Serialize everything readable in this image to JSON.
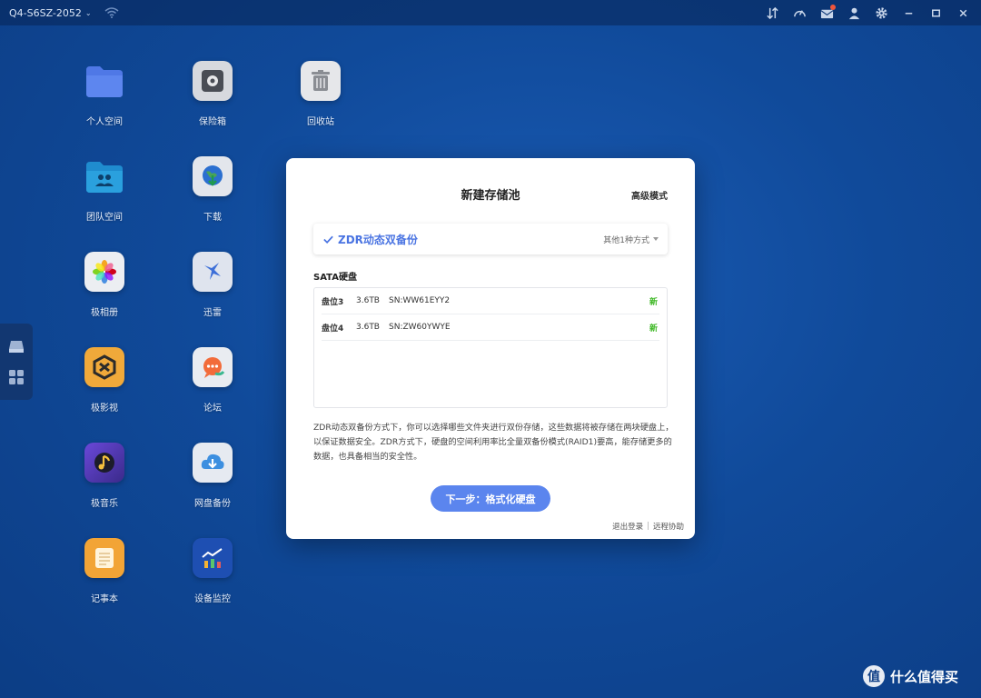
{
  "topbar": {
    "device_name": "Q4-S6SZ-2052",
    "icons": [
      "traffic-icon",
      "speedometer-icon",
      "message-icon",
      "user-icon",
      "gear-icon",
      "minimize-icon",
      "maximize-icon",
      "close-icon"
    ]
  },
  "desktop": {
    "apps": [
      {
        "label": "个人空间",
        "icon": "folder-icon"
      },
      {
        "label": "保险箱",
        "icon": "safe-icon"
      },
      {
        "label": "回收站",
        "icon": "trash-icon"
      },
      {
        "label": "团队空间",
        "icon": "team-folder-icon"
      },
      {
        "label": "下载",
        "icon": "download-globe-icon"
      },
      {
        "label": "极相册",
        "icon": "photos-icon"
      },
      {
        "label": "迅雷",
        "icon": "thunder-bird-icon"
      },
      {
        "label": "极影视",
        "icon": "video-icon"
      },
      {
        "label": "论坛",
        "icon": "forum-chat-icon"
      },
      {
        "label": "极音乐",
        "icon": "music-icon"
      },
      {
        "label": "网盘备份",
        "icon": "cloud-backup-icon"
      },
      {
        "label": "记事本",
        "icon": "notepad-icon"
      },
      {
        "label": "设备监控",
        "icon": "monitor-chart-icon"
      }
    ]
  },
  "dialog": {
    "title": "新建存储池",
    "advanced_mode": "高级模式",
    "mode": {
      "name": "ZDR动态双备份",
      "other_label": "其他1种方式"
    },
    "sata_title": "SATA硬盘",
    "disks": [
      {
        "slot": "盘位3",
        "capacity": "3.6TB",
        "sn": "SN:WW61EYY2",
        "status": "新"
      },
      {
        "slot": "盘位4",
        "capacity": "3.6TB",
        "sn": "SN:ZW60YWYE",
        "status": "新"
      }
    ],
    "description": "ZDR动态双备份方式下，你可以选择哪些文件夹进行双份存储，这些数据将被存储在两块硬盘上，以保证数据安全。ZDR方式下，硬盘的空间利用率比全量双备份模式(RAID1)要高，能存储更多的数据，也具备相当的安全性。",
    "next_button": "下一步：格式化硬盘",
    "footer": {
      "logout": "退出登录",
      "separator": "|",
      "remote_help": "远程协助"
    }
  },
  "watermark": {
    "logo_char": "值",
    "text": "什么值得买"
  },
  "colors": {
    "accent": "#5b85ee",
    "mode_text": "#4a74e2",
    "status_new": "#3fb826",
    "desktop_bg": "#104a9a"
  }
}
